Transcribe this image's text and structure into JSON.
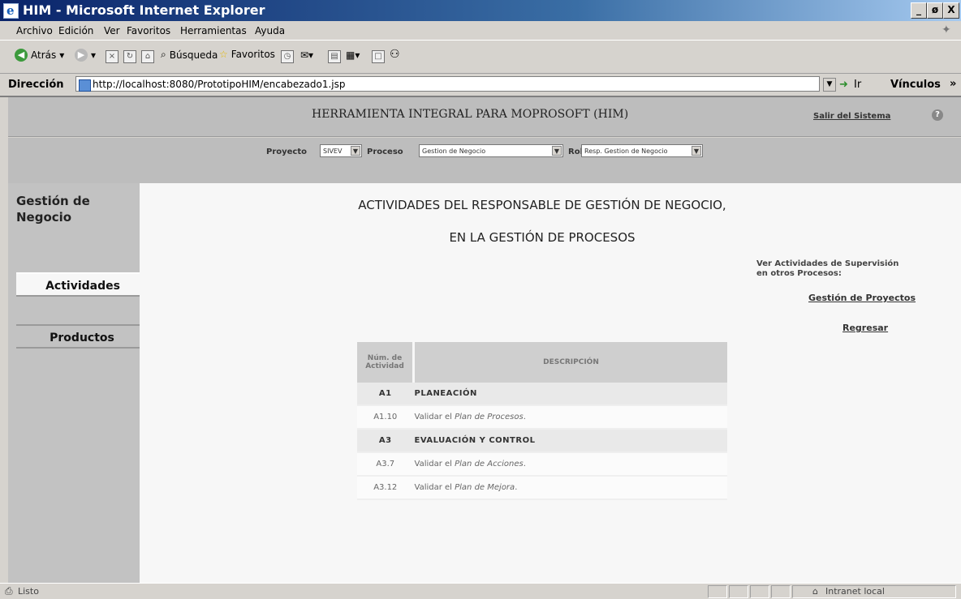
{
  "window": {
    "title": "HIM - Microsoft Internet Explorer",
    "buttons": {
      "minimize": "_",
      "maximize": "ø",
      "close": "X"
    }
  },
  "menu": [
    "Archivo",
    "Edición",
    "Ver",
    "Favoritos",
    "Herramientas",
    "Ayuda"
  ],
  "toolbar": {
    "back": "Atrás",
    "search": "Búsqueda",
    "favorites": "Favoritos"
  },
  "address": {
    "label": "Dirección",
    "url": "http://localhost:8080/PrototipoHIM/encabezado1.jsp",
    "go": "Ir",
    "links": "Vínculos"
  },
  "header": {
    "title": "HERRAMIENTA INTEGRAL PARA MOPROSOFT (HIM)",
    "exit": "Salir del Sistema"
  },
  "selectors": {
    "project_label": "Proyecto",
    "project_value": "SIVEV",
    "process_label": "Proceso",
    "process_value": "Gestion de Negocio",
    "role_label": "Rol",
    "role_value": "Resp. Gestion de Negocio"
  },
  "nav": {
    "heading_line1": "Gestión de",
    "heading_line2": "Negocio",
    "activities": "Actividades",
    "products": "Productos"
  },
  "main": {
    "title_line1": "ACTIVIDADES DEL RESPONSABLE DE GESTIÓN DE NEGOCIO,",
    "title_line2": "EN LA GESTIÓN DE PROCESOS",
    "supervision_line1": "Ver Actividades de Supervisión",
    "supervision_line2": "en otros Procesos:",
    "project_link": "Gestión de Proyectos",
    "back_link": "Regresar"
  },
  "table": {
    "col_num_line1": "Núm. de",
    "col_num_line2": "Actividad",
    "col_desc": "DESCRIPCIÓN",
    "rows": [
      {
        "num": "A1",
        "desc": "PLANEACIÓN",
        "type": "grp"
      },
      {
        "num": "A1.10",
        "desc_prefix": "Validar el ",
        "desc_italic": "Plan de Procesos",
        "desc_suffix": ".",
        "type": "sub"
      },
      {
        "num": "A3",
        "desc": "EVALUACIÓN Y CONTROL",
        "type": "grp"
      },
      {
        "num": "A3.7",
        "desc_prefix": "Validar el ",
        "desc_italic": "Plan de Acciones",
        "desc_suffix": ".",
        "type": "sub"
      },
      {
        "num": "A3.12",
        "desc_prefix": "Validar el ",
        "desc_italic": "Plan de Mejora",
        "desc_suffix": ".",
        "type": "sub"
      }
    ]
  },
  "status": {
    "left": "Listo",
    "zone": "Intranet local"
  }
}
